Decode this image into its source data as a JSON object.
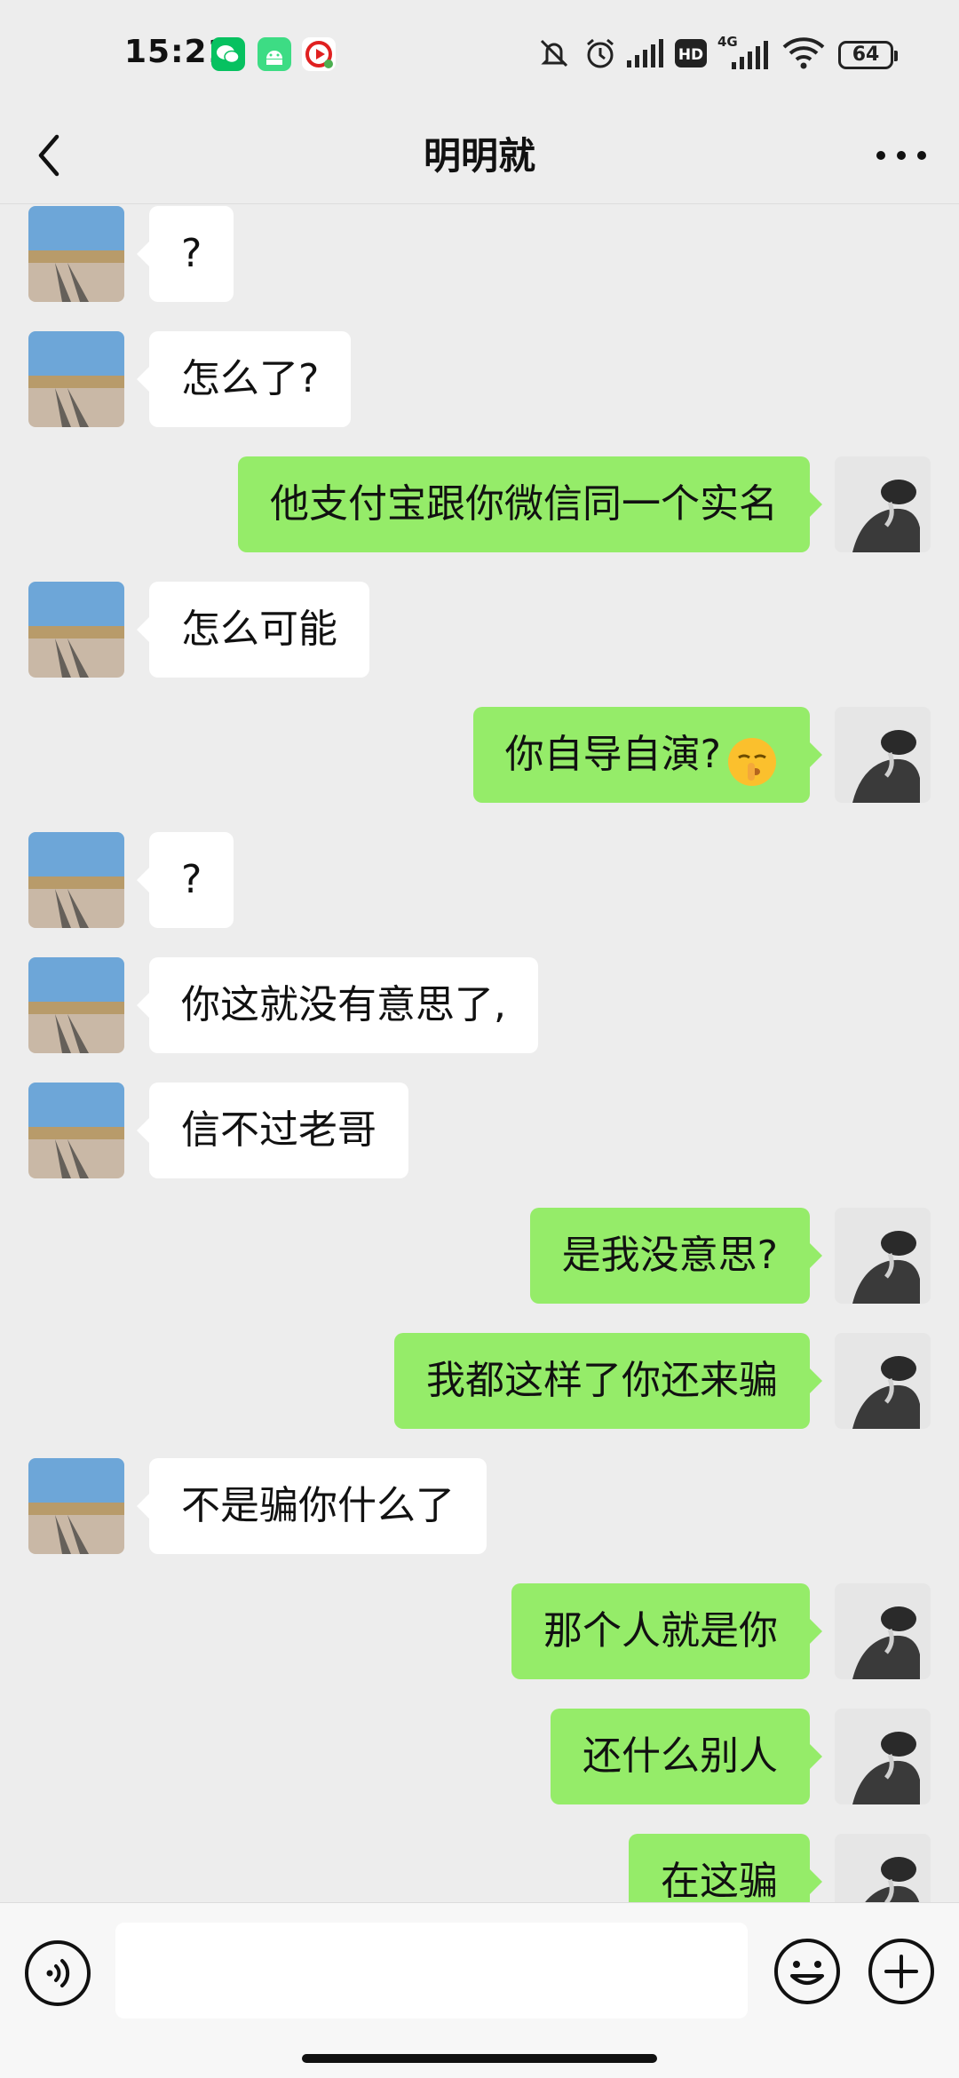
{
  "status_bar": {
    "time": "15:21",
    "battery": "64",
    "network": "4G",
    "hd_badge": "HD",
    "icons": [
      "wechat-icon",
      "android-app-icon",
      "video-app-icon",
      "mute-icon",
      "alarm-icon",
      "signal-icon",
      "hd-icon",
      "signal-4g-icon",
      "wifi-icon",
      "battery-icon"
    ]
  },
  "header": {
    "title": "明明就",
    "back_icon": "chevron-left-icon",
    "more_icon": "more-dots-icon"
  },
  "messages": [
    {
      "side": "in",
      "text": "?"
    },
    {
      "side": "in",
      "text": "怎么了?"
    },
    {
      "side": "out",
      "text": "他支付宝跟你微信同一个实名"
    },
    {
      "side": "in",
      "text": "怎么可能"
    },
    {
      "side": "out",
      "text": "你自导自演?",
      "emoji": "shushing-face-emoji"
    },
    {
      "side": "in",
      "text": "?"
    },
    {
      "side": "in",
      "text": "你这就没有意思了,"
    },
    {
      "side": "in",
      "text": "信不过老哥"
    },
    {
      "side": "out",
      "text": "是我没意思?"
    },
    {
      "side": "out",
      "text": "我都这样了你还来骗"
    },
    {
      "side": "in",
      "text": "不是骗你什么了"
    },
    {
      "side": "out",
      "text": "那个人就是你"
    },
    {
      "side": "out",
      "text": "还什么别人"
    },
    {
      "side": "out",
      "text": "在这骗"
    }
  ],
  "input_bar": {
    "voice_icon": "voice-mode-icon",
    "text_value": "",
    "emoji_icon": "smiley-icon",
    "plus_icon": "plus-circle-icon"
  },
  "colors": {
    "background": "#ededed",
    "incoming_bubble": "#ffffff",
    "outgoing_bubble": "#95ec69",
    "input_bar": "#f7f7f7"
  }
}
